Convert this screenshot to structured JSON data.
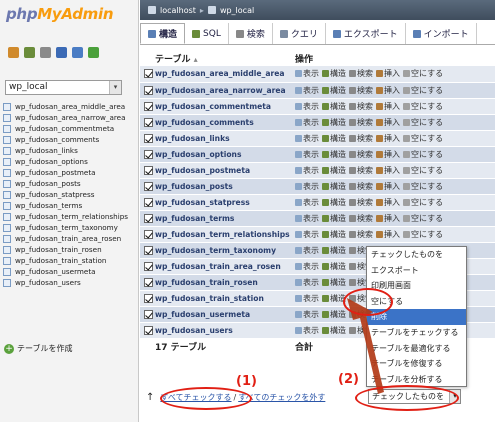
{
  "logo": {
    "part1": "php",
    "part2": "MyAdmin"
  },
  "nav_icons": [
    {
      "name": "home-icon",
      "color": "#d08a2c"
    },
    {
      "name": "sql-icon",
      "color": "#6a8c3a"
    },
    {
      "name": "query-window-icon",
      "color": "#8a8a8a"
    },
    {
      "name": "documentation-icon",
      "color": "#3b6ab5"
    },
    {
      "name": "help-icon",
      "color": "#4a7cc4"
    },
    {
      "name": "reload-icon",
      "color": "#4aa03a"
    }
  ],
  "db_select": {
    "value": "wp_local",
    "arrow": "▾"
  },
  "nav_tables": [
    "wp_fudosan_area_middle_area",
    "wp_fudosan_area_narrow_area",
    "wp_fudosan_commentmeta",
    "wp_fudosan_comments",
    "wp_fudosan_links",
    "wp_fudosan_options",
    "wp_fudosan_postmeta",
    "wp_fudosan_posts",
    "wp_fudosan_statpress",
    "wp_fudosan_terms",
    "wp_fudosan_term_relationships",
    "wp_fudosan_term_taxonomy",
    "wp_fudosan_train_area_rosen",
    "wp_fudosan_train_rosen",
    "wp_fudosan_train_station",
    "wp_fudosan_usermeta",
    "wp_fudosan_users"
  ],
  "create_table": {
    "icon": "+",
    "label": "テーブルを作成"
  },
  "breadcrumb": {
    "server": "localhost",
    "separator": "▸",
    "database": "wp_local"
  },
  "tabs": [
    {
      "label": "構造",
      "icon_color": "#5a7fb5",
      "active": true
    },
    {
      "label": "SQL",
      "icon_color": "#6a8c3a",
      "active": false
    },
    {
      "label": "検索",
      "icon_color": "#888888",
      "active": false
    },
    {
      "label": "クエリ",
      "icon_color": "#7a8aa0",
      "active": false
    },
    {
      "label": "エクスポート",
      "icon_color": "#5a7fb5",
      "active": false
    },
    {
      "label": "インポート",
      "icon_color": "#5a7fb5",
      "active": false
    }
  ],
  "table_header": {
    "table": "テーブル",
    "sort_arrow": "▴",
    "operations": "操作"
  },
  "operations": [
    "表示",
    "構造",
    "検索",
    "挿入",
    "空にする"
  ],
  "operation_icons": [
    "#8aa6c8",
    "#6a8c3a",
    "#888888",
    "#b07a3a",
    "#a0a0a0"
  ],
  "rows": [
    "wp_fudosan_area_middle_area",
    "wp_fudosan_area_narrow_area",
    "wp_fudosan_commentmeta",
    "wp_fudosan_comments",
    "wp_fudosan_links",
    "wp_fudosan_options",
    "wp_fudosan_postmeta",
    "wp_fudosan_posts",
    "wp_fudosan_statpress",
    "wp_fudosan_terms",
    "wp_fudosan_term_relationships",
    "wp_fudosan_term_taxonomy",
    "wp_fudosan_train_area_rosen",
    "wp_fudosan_train_rosen",
    "wp_fudosan_train_station",
    "wp_fudosan_usermeta",
    "wp_fudosan_users"
  ],
  "total_row": {
    "count_label": "17 テーブル",
    "sum_label": "合計"
  },
  "footer": {
    "arrow": "↑",
    "check_all": "すべてチェックする",
    "separator": "/",
    "uncheck_all": "すべてのチェックを外す",
    "with_selected_value": "チェックしたものを",
    "with_selected_arrow": "▾"
  },
  "dropdown_options": [
    {
      "label": "チェックしたものを",
      "selected": false
    },
    {
      "label": "エクスポート",
      "selected": false
    },
    {
      "label": "印刷用画面",
      "selected": false
    },
    {
      "label": "空にする",
      "selected": false
    },
    {
      "label": "削除",
      "selected": true
    },
    {
      "label": "テーブルをチェックする",
      "selected": false
    },
    {
      "label": "テーブルを最適化する",
      "selected": false
    },
    {
      "label": "テーブルを修復する",
      "selected": false
    },
    {
      "label": "テーブルを分析する",
      "selected": false
    }
  ],
  "annotations": {
    "step1": "(1)",
    "step2": "(2)"
  },
  "colors": {
    "annotation": "#e11f14",
    "arrow": "#b23a17",
    "selected": "#3b73c7"
  }
}
